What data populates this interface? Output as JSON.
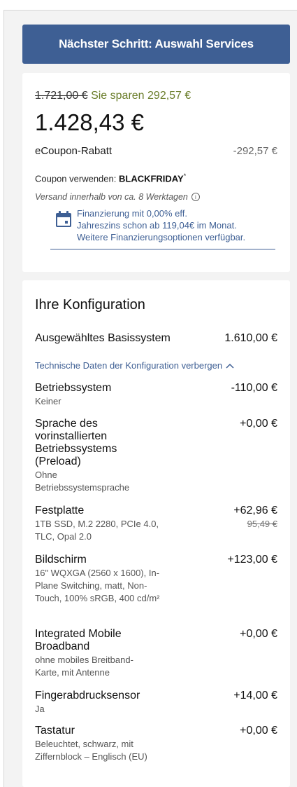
{
  "cta": {
    "label": "Nächster Schritt: Auswahl Services"
  },
  "pricing": {
    "old_price": "1.721,00 €",
    "savings_text": "Sie sparen 292,57 €",
    "current_price": "1.428,43 €",
    "ecoupon_label": "eCoupon-Rabatt",
    "ecoupon_value": "-292,57 €",
    "coupon_prefix": "Coupon verwenden:",
    "coupon_code": "BLACKFRIDAY",
    "coupon_mark": "*",
    "shipping_text": "Versand innerhalb von ca. 8 Werktagen",
    "financing_line1": "Finanzierung mit 0,00% eff.",
    "financing_line2": "Jahreszins schon ab 119,04€ im Monat.",
    "financing_line3": "Weitere Finanzierungsoptionen verfügbar."
  },
  "config": {
    "title": "Ihre Konfiguration",
    "base_label": "Ausgewähltes Basissystem",
    "base_price": "1.610,00 €",
    "tech_toggle": "Technische Daten der Konfiguration verbergen",
    "items": [
      {
        "name": "Betriebssystem",
        "sub": "Keiner",
        "price": "-110,00 €"
      },
      {
        "name": "Sprache des vorinstallierten Betriebssystems (Preload)",
        "sub": "Ohne Betriebssystemsprache",
        "price": "+0,00 €"
      },
      {
        "name": "Festplatte",
        "sub": "1TB SSD, M.2 2280, PCIe 4.0, TLC, Opal 2.0",
        "price": "+62,96 €",
        "old_price": "95,49 €"
      },
      {
        "name": "Bildschirm",
        "sub": "16\" WQXGA (2560 x 1600), In-Plane Switching, matt, Non-Touch, 100% sRGB, 400 cd/m²",
        "price": "+123,00 €"
      },
      {
        "name": "Integrated Mobile Broadband",
        "sub": "ohne mobiles Breitband-Karte, mit Antenne",
        "price": "+0,00 €"
      },
      {
        "name": "Fingerabdrucksensor",
        "sub": "Ja",
        "price": "+14,00 €"
      },
      {
        "name": "Tastatur",
        "sub": "Beleuchtet, schwarz, mit Ziffernblock – Englisch (EU)",
        "price": "+0,00 €"
      }
    ]
  },
  "icons": {
    "info": "info-icon",
    "calendar": "calendar-icon",
    "chevron": "chevron-up-icon"
  },
  "colors": {
    "accent": "#3e5f94",
    "savings": "#6a7d2a"
  }
}
